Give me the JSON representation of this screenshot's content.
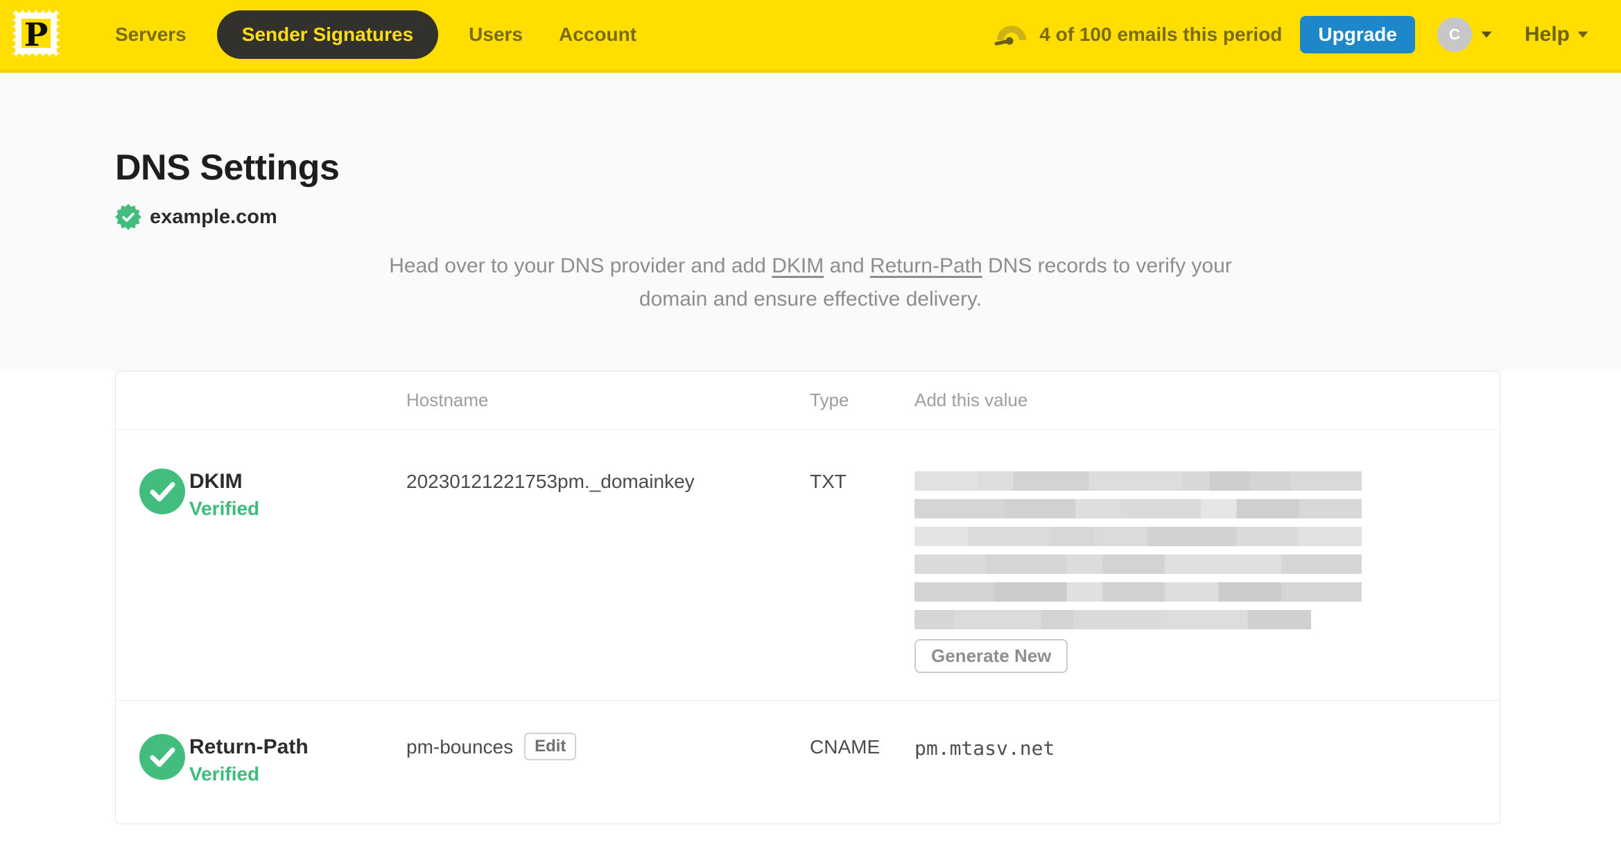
{
  "nav": {
    "logo_letter": "P",
    "items": [
      {
        "label": "Servers",
        "active": false
      },
      {
        "label": "Sender Signatures",
        "active": true
      },
      {
        "label": "Users",
        "active": false
      },
      {
        "label": "Account",
        "active": false
      }
    ],
    "usage_text": "4 of 100 emails this period",
    "upgrade_label": "Upgrade",
    "avatar_initial": "C",
    "help_label": "Help"
  },
  "hero": {
    "title": "DNS Settings",
    "domain": "example.com",
    "description": {
      "part1": "Head over to your DNS provider and add ",
      "dkim_link": "DKIM",
      "part2": " and ",
      "return_path_link": "Return-Path",
      "part3": " DNS records to verify your domain and ensure effective delivery."
    }
  },
  "table": {
    "headers": {
      "hostname": "Hostname",
      "type": "Type",
      "value": "Add this value"
    },
    "rows": [
      {
        "name": "DKIM",
        "status": "Verified",
        "hostname": "20230121221753pm._domainkey",
        "type": "TXT",
        "value_redacted": true,
        "action_label": "Generate New"
      },
      {
        "name": "Return-Path",
        "status": "Verified",
        "hostname": "pm-bounces",
        "edit_label": "Edit",
        "type": "CNAME",
        "value": "pm.mtasv.net"
      }
    ]
  },
  "colors": {
    "brand_yellow": "#FFDE00",
    "nav_text_olive": "#796c15",
    "nav_active_bg": "#32312c",
    "upgrade_blue": "#1e87c9",
    "verified_green": "#3ebc7a",
    "badge_green": "#42bd7e",
    "redacted_gray": "#d6d6d6"
  }
}
